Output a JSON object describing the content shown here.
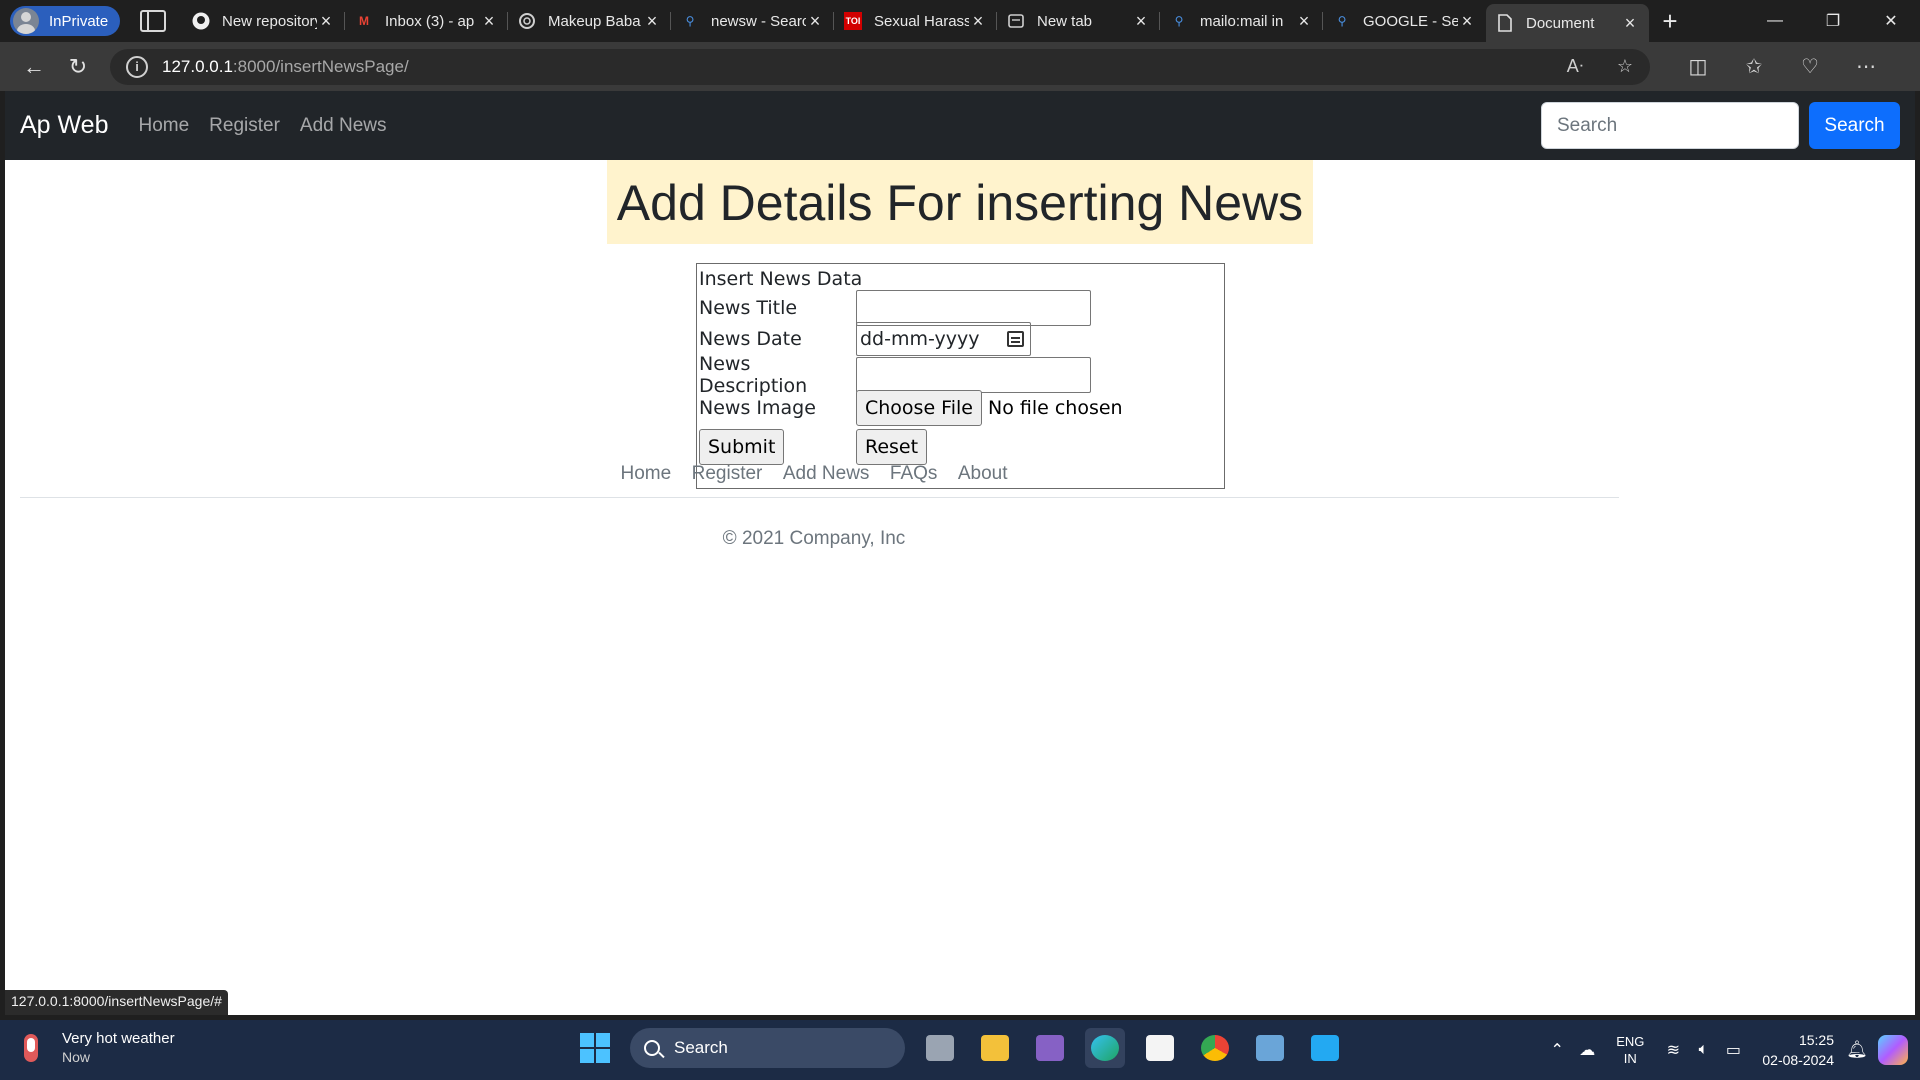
{
  "browser": {
    "profile_label": "InPrivate",
    "tabs": [
      {
        "title": "New repository",
        "fav": "github-icon"
      },
      {
        "title": "Inbox (3) - ap",
        "fav": "gmail-icon"
      },
      {
        "title": "Makeup Baba",
        "fav": "chatgpt-icon"
      },
      {
        "title": "newsw - Search",
        "fav": "search-icon"
      },
      {
        "title": "Sexual Harass",
        "fav": "toi-icon"
      },
      {
        "title": "New tab",
        "fav": "newtab-icon"
      },
      {
        "title": "mailo:mail in",
        "fav": "search-icon"
      },
      {
        "title": "GOOGLE - Se",
        "fav": "search-icon"
      },
      {
        "title": "Document",
        "fav": "document-icon"
      }
    ],
    "url_host": "127.0.0.1",
    "url_path": ":8000/insertNewsPage/",
    "status_url": "127.0.0.1:8000/insertNewsPage/#"
  },
  "navbar": {
    "brand": "Ap Web",
    "links": [
      "Home",
      "Register",
      "Add News"
    ],
    "search_placeholder": "Search",
    "search_button": "Search"
  },
  "page": {
    "heading": "Add Details For inserting News",
    "form": {
      "caption": "Insert News Data",
      "title_label": "News Title",
      "date_label": "News Date",
      "date_placeholder": "dd-mm-yyyy",
      "description_label": "News Description",
      "image_label": "News Image",
      "choose_file": "Choose File",
      "no_file": "No file chosen",
      "submit": "Submit",
      "reset": "Reset"
    }
  },
  "footer": {
    "links": [
      "Home",
      "Register",
      "Add News",
      "FAQs",
      "About"
    ],
    "copyright": "© 2021 Company, Inc"
  },
  "taskbar": {
    "weather_title": "Very hot weather",
    "weather_sub": "Now",
    "search_label": "Search",
    "lang_line1": "ENG",
    "lang_line2": "IN",
    "time": "15:25",
    "date": "02-08-2024"
  },
  "colors": {
    "navbar_bg": "#212529",
    "heading_bg": "#fff3cd",
    "primary": "#0d6efd",
    "muted": "#6c757d"
  }
}
